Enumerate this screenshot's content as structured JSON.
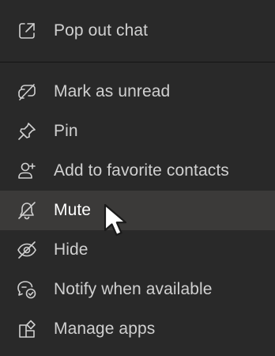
{
  "menu": {
    "items": [
      {
        "id": "pop-out-chat",
        "label": "Pop out chat",
        "icon": "pop-out-icon"
      },
      {
        "id": "mark-as-unread",
        "label": "Mark as unread",
        "icon": "mark-unread-icon"
      },
      {
        "id": "pin",
        "label": "Pin",
        "icon": "pin-icon"
      },
      {
        "id": "add-to-favorite-contacts",
        "label": "Add to favorite contacts",
        "icon": "add-person-icon"
      },
      {
        "id": "mute",
        "label": "Mute",
        "icon": "bell-off-icon",
        "state": "hovered"
      },
      {
        "id": "hide",
        "label": "Hide",
        "icon": "eye-off-icon"
      },
      {
        "id": "notify-when-available",
        "label": "Notify when available",
        "icon": "notify-status-icon"
      },
      {
        "id": "manage-apps",
        "label": "Manage apps",
        "icon": "apps-icon"
      }
    ]
  },
  "colors": {
    "background": "#292929",
    "hover_background": "#3b3a39",
    "text": "#d0d0d0",
    "divider": "#141414"
  }
}
